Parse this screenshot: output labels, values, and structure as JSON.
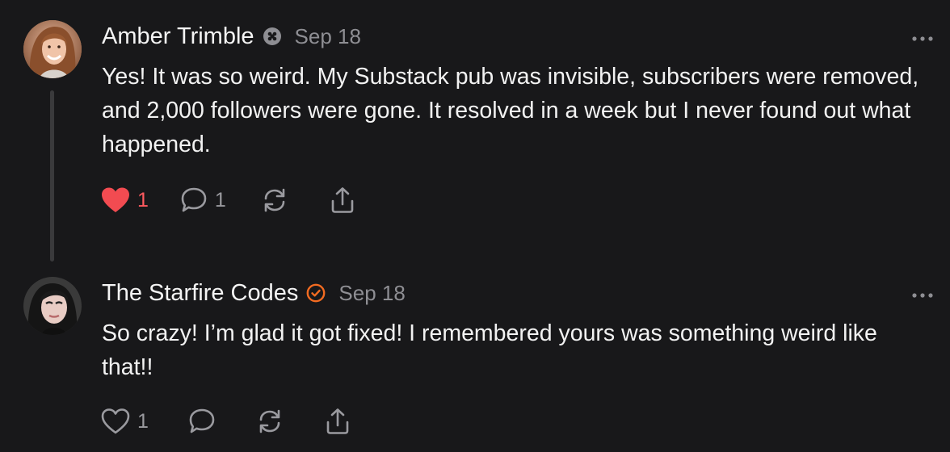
{
  "comments": [
    {
      "author": "Amber Trimble",
      "date": "Sep 18",
      "text": "Yes! It was so weird. My Substack pub was invisible, subscribers were removed, and 2,000 followers were gone. It resolved in a week but I never found out what happened.",
      "likes": "1",
      "replies": "1",
      "liked": true,
      "badge_icon": "grid-badge-icon"
    },
    {
      "author": "The Starfire Codes",
      "date": "Sep 18",
      "text": "So crazy! I’m glad it got fixed! I remembered yours was something weird like that!!",
      "likes": "1",
      "replies": "",
      "liked": false,
      "badge_icon": "verified-check-icon"
    }
  ],
  "colors": {
    "background": "#18181a",
    "like_active": "#ff5a5f",
    "verified_badge": "#f26b21",
    "muted": "#8e8e93",
    "thread_line": "#3a3a3c"
  },
  "icons": [
    "heart-icon",
    "comment-icon",
    "restack-icon",
    "share-icon",
    "more-options-icon"
  ]
}
